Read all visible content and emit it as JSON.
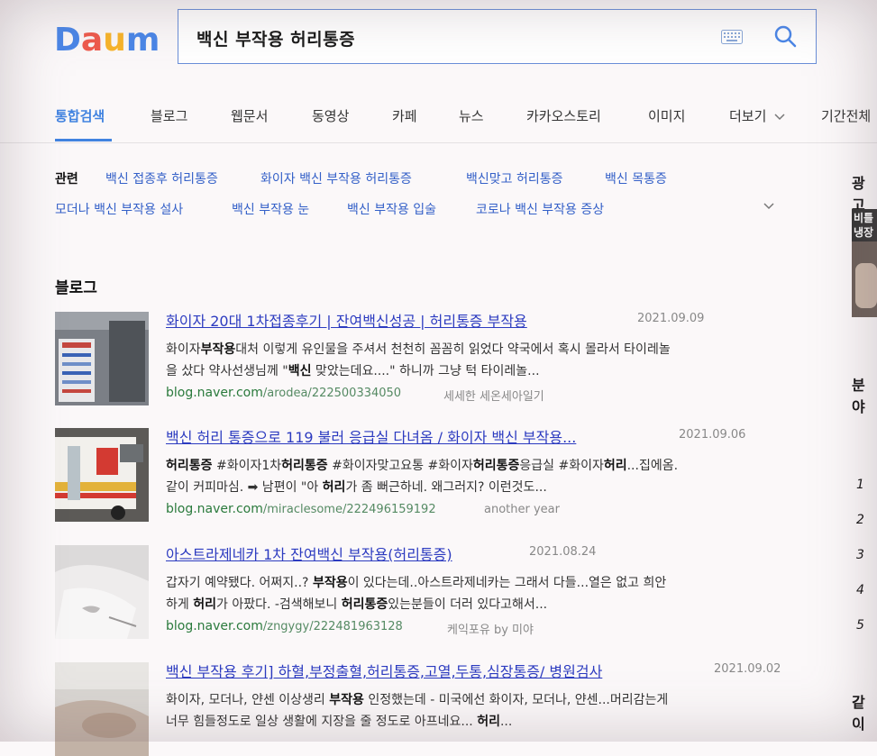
{
  "header": {
    "logo_text": "Daum",
    "query": "백신 부작용 허리통증"
  },
  "tabs": [
    {
      "label": "통합검색",
      "active": true
    },
    {
      "label": "블로그"
    },
    {
      "label": "웹문서"
    },
    {
      "label": "동영상"
    },
    {
      "label": "카페"
    },
    {
      "label": "뉴스"
    },
    {
      "label": "카카오스토리"
    },
    {
      "label": "이미지"
    },
    {
      "label": "더보기"
    },
    {
      "label": "기간전체"
    }
  ],
  "related": {
    "label": "관련",
    "row1": [
      "백신 접종후 허리통증",
      "화이자 백신 부작용 허리통증",
      "백신맞고 허리통증",
      "백신 목통증"
    ],
    "row2": [
      "모더나 백신 부작용 설사",
      "백신 부작용 눈",
      "백신 부작용 입술",
      "코로나 백신 부작용 증상"
    ]
  },
  "blog": {
    "heading": "블로그",
    "results": [
      {
        "title": "화이자 20대 1차접종후기 | 잔여백신성공 | 허리통증 부작용",
        "date": "2021.09.09",
        "snippet_line1": "화이자부작용대처 이렇게 유인물을 주셔서 천천히 꼼꼼히 읽었다 약국에서 혹시 몰라서 타이레놀",
        "snippet_line2": "을 샀다 약사선생님께 \"백신 맞았는데요....\" 하니까 그냥 턱 타이레놀...",
        "url_domain": "blog.naver.com",
        "url_path": "/arodea/222500334050",
        "author": "세세한 세온세아일기"
      },
      {
        "title": "백신 허리 통증으로 119 불러 응급실 다녀옴 / 화이자 백신 부작용...",
        "date": "2021.09.06",
        "snippet_line1": "허리통증 #화이자1차허리통증 #화이자맞고요통 #화이자허리통증응급실 #화이자허리...집에옴.",
        "snippet_line2": "같이 커피마심. ➡ 남편이 \"아 허리가 좀 뻐근하네. 왜그러지? 이런것도...",
        "url_domain": "blog.naver.com",
        "url_path": "/miraclesome/222496159192",
        "author": "another year"
      },
      {
        "title": "아스트라제네카 1차 잔여백신 부작용(허리통증)",
        "date": "2021.08.24",
        "snippet_line1": "갑자기 예약됐다. 어쩌지..? 부작용이 있다는데..아스트라제네카는 그래서 다들...열은 없고 희안",
        "snippet_line2": "하게 허리가 아팠다. -검색해보니 허리통증있는분들이 더러 있다고해서...",
        "url_domain": "blog.naver.com",
        "url_path": "/zngygy/222481963128",
        "author": "케익포유 by 미야"
      },
      {
        "title": "백신 부작용 후기] 하혈,부정출혈,허리통증,고열,두통,심장통증/ 병원검사",
        "date": "2021.09.02",
        "snippet_line1": "화이자, 모더나, 얀센 이상생리 부작용 인정했는데 - 미국에선 화이자, 모더나, 얀센...머리감는게",
        "snippet_line2": "너무 힘들정도로 일상 생활에 지장을 줄 정도로 아프네요...   허리..."
      }
    ]
  },
  "sidebar": {
    "ad_label": "광고",
    "ad_text_1": "비틀",
    "ad_text_2": "냉장",
    "section1_label": "분야",
    "ranks": [
      "1",
      "2",
      "3",
      "4",
      "5"
    ],
    "section2_label": "같이"
  },
  "colors": {
    "accent": "#4183e0",
    "link": "#2c3bc0",
    "url_green": "#2a7a3c",
    "related_link": "#3460c8"
  }
}
